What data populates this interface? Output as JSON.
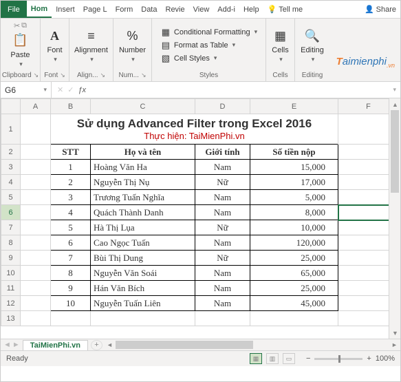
{
  "tabs": {
    "file": "File",
    "list": [
      "Hom",
      "Insert",
      "Page L",
      "Form",
      "Data",
      "Revie",
      "View",
      "Add-i",
      "Help"
    ],
    "active_index": 0,
    "tellme": "Tell me",
    "share": "Share"
  },
  "ribbon": {
    "clipboard": {
      "paste": "Paste",
      "label": "Clipboard"
    },
    "font": {
      "btn": "Font",
      "label": "Font"
    },
    "alignment": {
      "btn": "Alignment",
      "label": "Align..."
    },
    "number": {
      "btn": "Number",
      "label": "Num..."
    },
    "styles": {
      "cf": "Conditional Formatting",
      "fat": "Format as Table",
      "cs": "Cell Styles",
      "label": "Styles"
    },
    "cells": {
      "btn": "Cells",
      "label": "Cells"
    },
    "editing": {
      "btn": "Editing",
      "label": "Editing"
    }
  },
  "logo": {
    "prefix": "T",
    "rest": "aimienphi",
    "suffix": ".vn"
  },
  "namebox": "G6",
  "fx": "ƒx",
  "columns": [
    "A",
    "B",
    "C",
    "D",
    "E",
    "F"
  ],
  "row_count": 13,
  "selected_row": 6,
  "title": "Sử dụng Advanced Filter trong Excel 2016",
  "subtitle": "Thực hiện: TaiMienPhi.vn",
  "headers": {
    "stt": "STT",
    "name": "Họ và tên",
    "sex": "Giới tính",
    "amount": "Số tiền nộp"
  },
  "rows": [
    {
      "stt": "1",
      "name": "Hoàng Văn Ha",
      "sex": "Nam",
      "amount": "15,000"
    },
    {
      "stt": "2",
      "name": "Nguyễn Thị Nụ",
      "sex": "Nữ",
      "amount": "17,000"
    },
    {
      "stt": "3",
      "name": "Trương Tuấn Nghĩa",
      "sex": "Nam",
      "amount": "5,000"
    },
    {
      "stt": "4",
      "name": "Quách Thành Danh",
      "sex": "Nam",
      "amount": "8,000"
    },
    {
      "stt": "5",
      "name": "Hà Thị Lụa",
      "sex": "Nữ",
      "amount": "10,000"
    },
    {
      "stt": "6",
      "name": "Cao Ngọc Tuấn",
      "sex": "Nam",
      "amount": "120,000"
    },
    {
      "stt": "7",
      "name": "Bùi Thị Dung",
      "sex": "Nữ",
      "amount": "25,000"
    },
    {
      "stt": "8",
      "name": "Nguyễn Văn Soái",
      "sex": "Nam",
      "amount": "65,000"
    },
    {
      "stt": "9",
      "name": "Hán Văn Bích",
      "sex": "Nam",
      "amount": "25,000"
    },
    {
      "stt": "10",
      "name": "Nguyễn Tuấn Liên",
      "sex": "Nam",
      "amount": "45,000"
    }
  ],
  "sheet": "TaiMienPhi.vn",
  "status": {
    "ready": "Ready",
    "zoom": "100%"
  }
}
